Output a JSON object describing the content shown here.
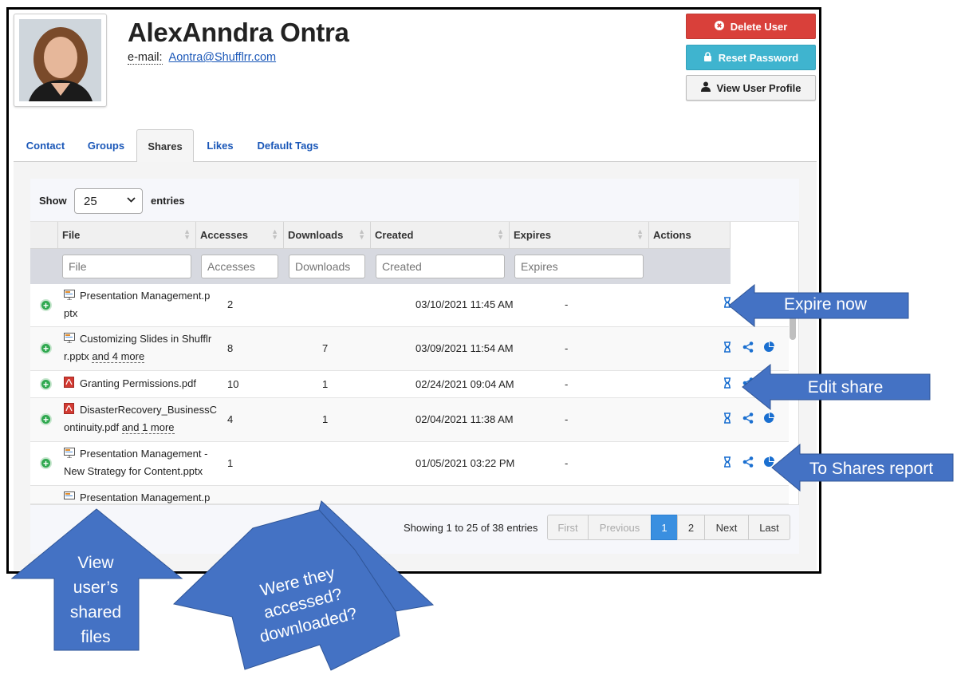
{
  "user": {
    "name": "AlexAnndra Ontra",
    "email_label": "e-mail:",
    "email": "Aontra@Shufflrr.com"
  },
  "header_buttons": {
    "delete_label": "Delete User",
    "reset_label": "Reset Password",
    "profile_label": "View User Profile"
  },
  "tabs": [
    {
      "label": "Contact"
    },
    {
      "label": "Groups"
    },
    {
      "label": "Shares",
      "active": true
    },
    {
      "label": "Likes"
    },
    {
      "label": "Default Tags"
    }
  ],
  "length_control": {
    "show_label": "Show",
    "value": "25",
    "entries_label": "entries"
  },
  "columns": [
    {
      "label": "File",
      "filter_placeholder": "File"
    },
    {
      "label": "Accesses",
      "filter_placeholder": "Accesses"
    },
    {
      "label": "Downloads",
      "filter_placeholder": "Downloads"
    },
    {
      "label": "Created",
      "filter_placeholder": "Created"
    },
    {
      "label": "Expires",
      "filter_placeholder": "Expires"
    },
    {
      "label": "Actions"
    }
  ],
  "rows": [
    {
      "file_line1": "Presentation Management.p",
      "file_line2": "ptx",
      "more": "",
      "type": "pptx",
      "accesses": "2",
      "downloads": "",
      "created": "03/10/2021 11:45 AM",
      "expires": "-"
    },
    {
      "file_line1": "Customizing Slides in Shufflr",
      "file_line2": "r.pptx",
      "more": "and 4 more",
      "type": "pptx",
      "accesses": "8",
      "downloads": "7",
      "created": "03/09/2021 11:54 AM",
      "expires": "-"
    },
    {
      "file_line1": "Granting Permissions.pdf",
      "file_line2": "",
      "more": "",
      "type": "pdf",
      "accesses": "10",
      "downloads": "1",
      "created": "02/24/2021 09:04 AM",
      "expires": "-"
    },
    {
      "file_line1": "DisasterRecovery_BusinessC",
      "file_line2": "ontinuity.pdf",
      "more": "and 1 more",
      "type": "pdf",
      "accesses": "4",
      "downloads": "1",
      "created": "02/04/2021 11:38 AM",
      "expires": "-"
    },
    {
      "file_line1": "Presentation Management -",
      "file_line2": "New Strategy for Content.pptx",
      "more": "",
      "type": "pptx",
      "accesses": "1",
      "downloads": "",
      "created": "01/05/2021 03:22 PM",
      "expires": "-"
    },
    {
      "file_line1": "Presentation Management.p",
      "file_line2": "",
      "more": "",
      "type": "pptx",
      "accesses": "",
      "downloads": "",
      "created": "",
      "expires": ""
    }
  ],
  "pagination": {
    "info": "Showing 1 to 25 of 38 entries",
    "first": "First",
    "previous": "Previous",
    "page1": "1",
    "page2": "2",
    "next": "Next",
    "last": "Last"
  },
  "annotations": {
    "expire_now": "Expire now",
    "edit_share": "Edit share",
    "to_shares_report": "To Shares report",
    "view_files_1": "View",
    "view_files_2": "user’s",
    "view_files_3": "shared",
    "view_files_4": "files",
    "accessed_1": "Were they",
    "accessed_2": "accessed?",
    "accessed_3": "downloaded?"
  },
  "colors": {
    "delete_button": "#d9403a",
    "reset_button": "#3fb4cf",
    "link": "#1a57b8",
    "current_page": "#3a8fe0",
    "callout": "#4472c4",
    "plus_icon": "#2fa84f"
  }
}
